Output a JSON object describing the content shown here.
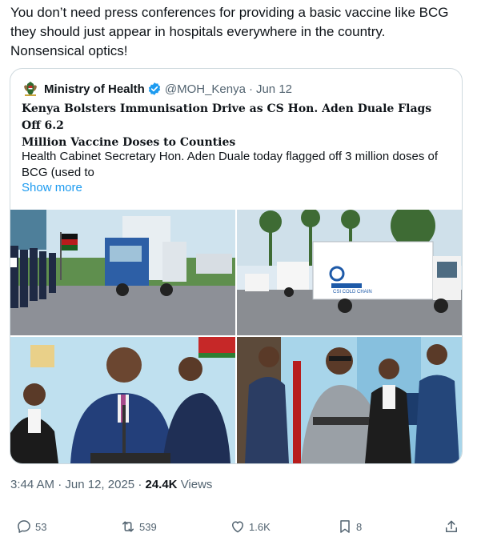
{
  "tweet": {
    "text_lines": [
      "You don’t need press conferences for providing a basic vaccine like BCG",
      "they should just appear in hospitals everywhere in the country.",
      "Nonsensical optics!"
    ]
  },
  "quote": {
    "author_name": "Ministry of Health",
    "handle": "@MOH_Kenya",
    "separator": "·",
    "date": "Jun 12",
    "headline_lines": [
      "Kenya Bolsters Immunisation Drive as CS Hon. Aden Duale Flags Off 6.2",
      "Million Vaccine Doses to Counties"
    ],
    "body_lines": [
      "Health Cabinet Secretary Hon. Aden Duale today flagged off 3 million doses of",
      "BCG (used to"
    ],
    "show_more": "Show more",
    "truck_brand_text": "CSI COLD CHAIN"
  },
  "meta": {
    "time": "3:44 AM",
    "dot": "·",
    "date": "Jun 12, 2025",
    "views_count": "24.4K",
    "views_label": "Views"
  },
  "actions": {
    "replies": "53",
    "reposts": "539",
    "likes": "1.6K",
    "bookmarks": "8"
  },
  "colors": {
    "accent": "#1d9bf0",
    "muted": "#536471",
    "border": "#cfd9de"
  },
  "icons": [
    "coat-of-arms-avatar-icon",
    "verified-badge-icon",
    "reply-icon",
    "repost-icon",
    "like-icon",
    "bookmark-icon",
    "share-icon"
  ]
}
